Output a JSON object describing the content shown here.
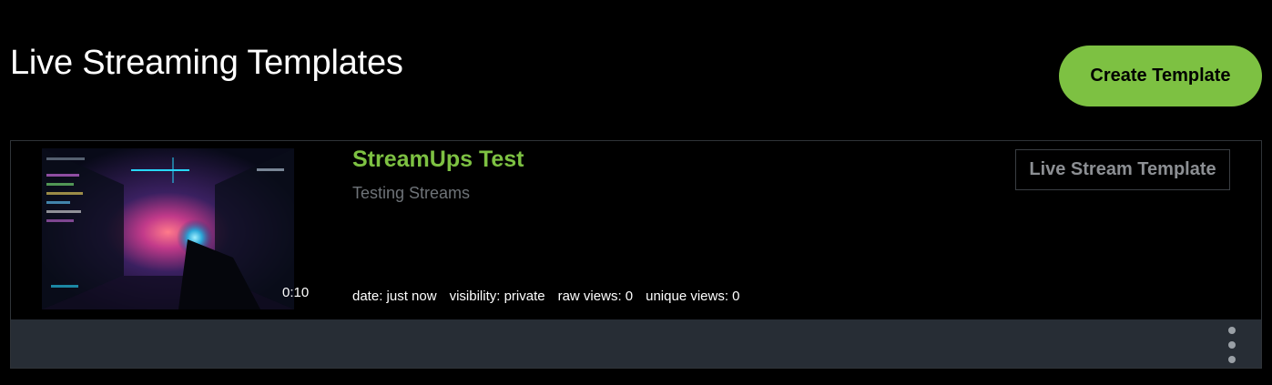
{
  "header": {
    "title": "Live Streaming Templates",
    "create_label": "Create Template"
  },
  "colors": {
    "accent": "#7dc142",
    "footer_bg": "#272d35",
    "muted_text": "#6e7378"
  },
  "templates": [
    {
      "title": "StreamUps Test",
      "description": "Testing Streams",
      "type_label": "Live Stream Template",
      "duration": "0:10",
      "meta": {
        "date": "date: just now",
        "visibility": "visibility: private",
        "raw_views": "raw views: 0",
        "unique_views": "unique views: 0"
      },
      "menu_icon": "kebab-vertical-icon"
    }
  ]
}
